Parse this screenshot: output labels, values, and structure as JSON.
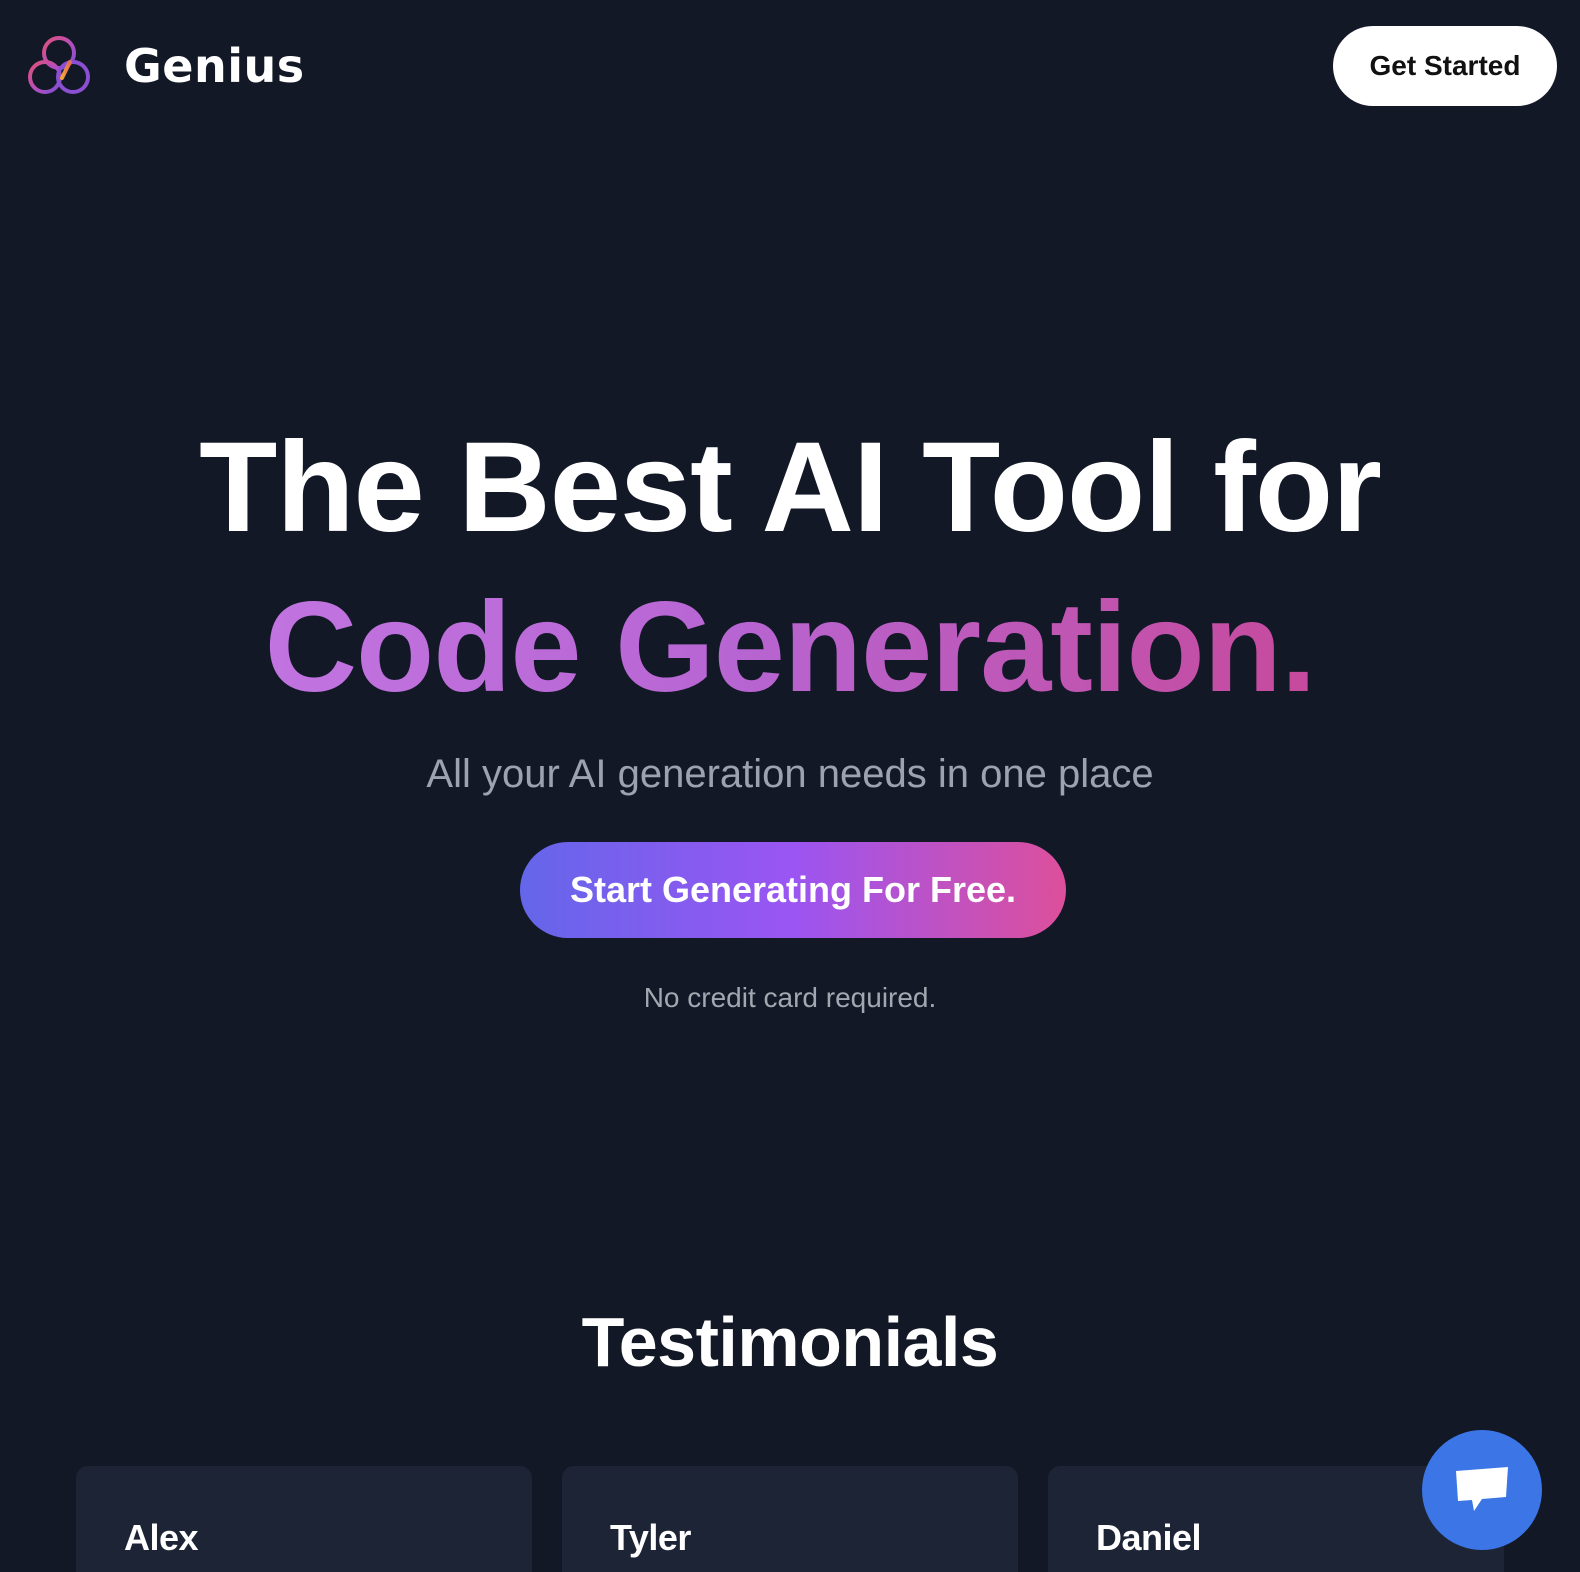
{
  "header": {
    "brand": "Genius",
    "get_started_label": "Get Started"
  },
  "hero": {
    "title_line1": "The Best AI Tool for",
    "title_line2": "Code Generation.",
    "subtitle": "All your AI generation needs in one place",
    "cta_label": "Start Generating For Free.",
    "note": "No credit card required."
  },
  "testimonials": {
    "title": "Testimonials",
    "cards": [
      {
        "name": "Alex"
      },
      {
        "name": "Tyler"
      },
      {
        "name": "Daniel"
      }
    ]
  },
  "icons": {
    "logo": "genius-logo-icon",
    "chat": "chat-icon"
  },
  "colors": {
    "background": "#121826",
    "card": "#1d2435",
    "cta_gradient_start": "#6466ea",
    "cta_gradient_mid": "#9b55f2",
    "cta_gradient_end": "#dd4f9b",
    "accent_text_start": "#c174e0",
    "accent_text_end": "#c64a9c",
    "chat_button": "#3b75e6"
  }
}
